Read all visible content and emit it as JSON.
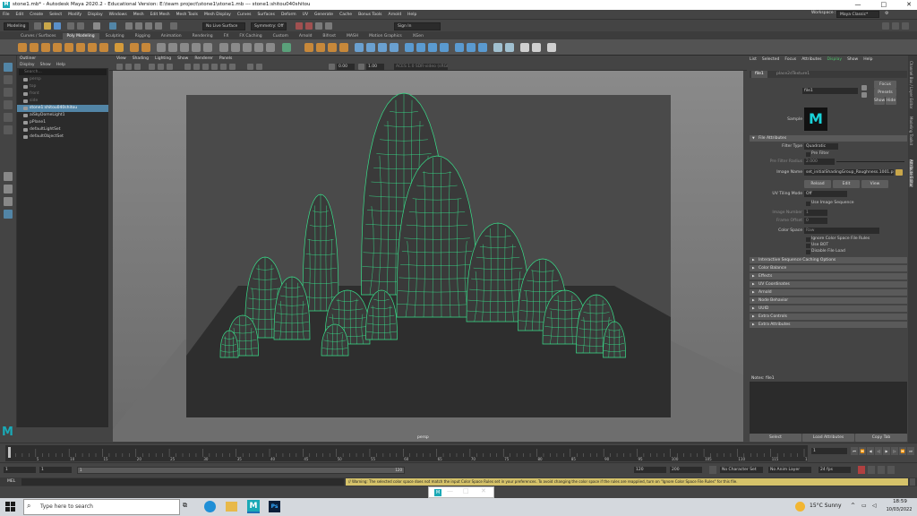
{
  "window": {
    "title": "stone1.mb* - Autodesk Maya 2020.2 - Educational Version: E:\\team project\\stone1\\stone1.mb  ---  stone1:shitou040shitou",
    "controls": [
      "—",
      "□",
      "✕"
    ]
  },
  "menubar": [
    "File",
    "Edit",
    "Create",
    "Select",
    "Modify",
    "Display",
    "Windows",
    "Mesh",
    "Edit Mesh",
    "Mesh Tools",
    "Mesh Display",
    "Curves",
    "Surfaces",
    "Deform",
    "UV",
    "Generate",
    "Cache",
    "Bonus Tools",
    "Arnold",
    "Help"
  ],
  "workspace": {
    "label": "Workspace :",
    "value": "Maya Classic*"
  },
  "statusline": {
    "mode": "Modeling",
    "live_surface": "No Live Surface",
    "symmetry": "Symmetry: Off",
    "signin": "Sign In"
  },
  "shelf_tabs": [
    "Curves / Surfaces",
    "Poly Modeling",
    "Sculpting",
    "Rigging",
    "Animation",
    "Rendering",
    "FX",
    "FX Caching",
    "Custom",
    "Arnold",
    "Bifrost",
    "MASH",
    "Motion Graphics",
    "XGen"
  ],
  "shelf_tabs_active": 1,
  "outliner": {
    "title": "Outliner",
    "menus": [
      "Display",
      "Show",
      "Help"
    ],
    "search_placeholder": "Search...",
    "items": [
      {
        "label": "persp",
        "dim": true
      },
      {
        "label": "top",
        "dim": true
      },
      {
        "label": "front",
        "dim": true
      },
      {
        "label": "side",
        "dim": true
      },
      {
        "label": "stone1:shitou040shitou",
        "selected": true
      },
      {
        "label": "aiSkyDomeLight1"
      },
      {
        "label": "pPlane1"
      },
      {
        "label": "defaultLightSet"
      },
      {
        "label": "defaultObjectSet"
      }
    ]
  },
  "viewport": {
    "menus": [
      "View",
      "Shading",
      "Lighting",
      "Show",
      "Renderer",
      "Panels"
    ],
    "exposure": "0.00",
    "gamma": "1.00",
    "colorspace": "ACES 1.0 SDR-video (sRGB)",
    "camera": "persp",
    "wire_color": "#38e08a"
  },
  "attribute_editor": {
    "tabs": [
      "List",
      "Selected",
      "Focus",
      "Attributes",
      "Display",
      "Show",
      "Help"
    ],
    "node_tabs": [
      "file1",
      "place2dTexture1"
    ],
    "file_label": "file:",
    "file_value": "file1",
    "focus_btn": "Focus",
    "presets_btn": "Presets",
    "show_btn": "Show",
    "hide_btn": "Hide",
    "sample_label": "Sample",
    "sections_open": "File Attributes",
    "filter_type_label": "Filter Type",
    "filter_type_value": "Quadratic",
    "pre_filter_label": "Pre Filter",
    "pre_filter_radius_label": "Pre Filter Radius",
    "pre_filter_radius_value": "2.000",
    "image_name_label": "Image Name",
    "image_name_value": "set_initialShadingGroup_Roughness.1001.png",
    "reload_btn": "Reload",
    "edit_btn": "Edit",
    "view_btn": "View",
    "uv_tiling_label": "UV Tiling Mode",
    "uv_tiling_value": "Off",
    "use_image_seq_label": "Use Image Sequence",
    "image_number_label": "Image Number",
    "image_number_value": "1",
    "frame_offset_label": "Frame Offset",
    "frame_offset_value": "0",
    "color_space_label": "Color Space",
    "color_space_value": "Raw",
    "ignore_rules_label": "Ignore Color Space File Rules",
    "use_bot_label": "Use BOT",
    "disable_file_load_label": "Disable File Load",
    "collapsed_sections": [
      "Interactive Sequence Caching Options",
      "Color Balance",
      "Effects",
      "UV Coordinates",
      "Arnold",
      "Node Behavior",
      "UUID",
      "Extra Controls",
      "Extra Attributes"
    ],
    "notes_label": "Notes: file1",
    "select_btn": "Select",
    "load_attr_btn": "Load Attributes",
    "copy_tab_btn": "Copy Tab"
  },
  "side_tabs": [
    "Channel Box / Layer Editor",
    "Modeling Toolkit",
    "Attribute Editor"
  ],
  "timeline": {
    "ticks": [
      "5",
      "10",
      "15",
      "20",
      "25",
      "30",
      "35",
      "40",
      "45",
      "50",
      "55",
      "60",
      "65",
      "70",
      "75",
      "80",
      "85",
      "90",
      "95",
      "100",
      "105",
      "110",
      "115",
      "120"
    ],
    "current_frame": "1"
  },
  "range": {
    "start": "1",
    "inner_start": "1",
    "inner_end": "120",
    "end1": "120",
    "end2": "200",
    "char_set": "No Character Set",
    "anim_layer": "No Anim Layer",
    "fps": "24 fps"
  },
  "mel": {
    "label": "MEL",
    "warning": "// Warning: The selected color space does not match the input Color Space Rules set in your preferences. To avoid changing the color space if the rules are reapplied, turn on \"Ignore Color Space File Rules\" for this file."
  },
  "taskbar": {
    "search_placeholder": "Type here to search",
    "weather": "15°C  Sunny",
    "time": "18:59",
    "date": "10/03/2022"
  }
}
